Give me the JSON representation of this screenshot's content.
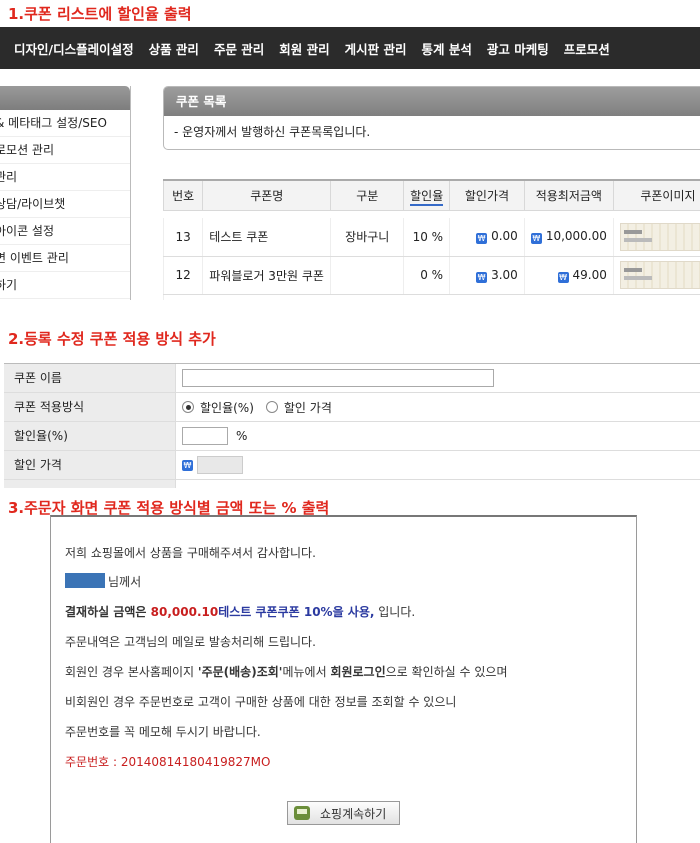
{
  "section1": {
    "title": "1.쿠폰 리스트에 할인율 출력",
    "nav": [
      "디자인/디스플레이설정",
      "상품 관리",
      "주문 관리",
      "회원 관리",
      "게시판 관리",
      "통계 분석",
      "광고 마케팅",
      "프로모션"
    ],
    "sidebar": [
      "& 메타태그 설정/SEO",
      "로모션 관리",
      "관리",
      "상담/라이브챗",
      "아이콘 설정",
      "면 이벤트 관리",
      "하기"
    ],
    "box_title": "쿠폰 목록",
    "box_desc": "- 운영자께서 발행하신 쿠폰목록입니다.",
    "table": {
      "headers": [
        "번호",
        "쿠폰명",
        "구분",
        "할인율",
        "할인가격",
        "적용최저금액",
        "쿠폰이미지"
      ],
      "money_icon": "₩",
      "rows": [
        {
          "no": "13",
          "name": "테스트 쿠폰",
          "type": "장바구니",
          "rate": "10 %",
          "price": "0.00",
          "min": "10,000.00"
        },
        {
          "no": "12",
          "name": "파워블로거 3만원 쿠폰",
          "type": "",
          "rate": "0 %",
          "price": "3.00",
          "min": "49.00"
        }
      ]
    }
  },
  "section2": {
    "title": "2.등록 수정 쿠폰 적용 방식 추가",
    "rows": {
      "name_label": "쿠폰 이름",
      "method_label": "쿠폰 적용방식",
      "method_options": [
        "할인율(%)",
        "할인 가격"
      ],
      "rate_label": "할인율(%)",
      "rate_unit": "%",
      "price_label": "할인 가격"
    }
  },
  "section3": {
    "title": "3.주문자 화면 쿠폰 적용 방식별 금액 또는 %  출력",
    "thanks": "저희 쇼핑몰에서 상품을 구매해주셔서 감사합니다.",
    "customer_suffix": "님께서",
    "pay_prefix": "결재하실 금액은 ",
    "pay_amount": "80,000.10",
    "pay_coupon": "테스트 쿠폰쿠폰 10%을 사용,",
    "pay_suffix": " 입니다.",
    "mail_line": "주문내역은 고객님의 메일로 발송처리해 드립니다.",
    "member_pre": "회원인 경우 본사홈페이지 ",
    "member_menu": "'주문(배송)조회'",
    "member_mid": "메뉴에서 ",
    "member_login": "회원로그인",
    "member_post": "으로 확인하실 수 있으며",
    "guest_line": "비회원인 경우 주문번호로 고객이 구매한 상품에 대한 정보를 조회할 수 있으니",
    "memo_line": "주문번호를 꼭 메모해 두시기 바랍니다.",
    "order_no": "주문번호 : 20140814180419827MO",
    "button": "쇼핑계속하기"
  }
}
